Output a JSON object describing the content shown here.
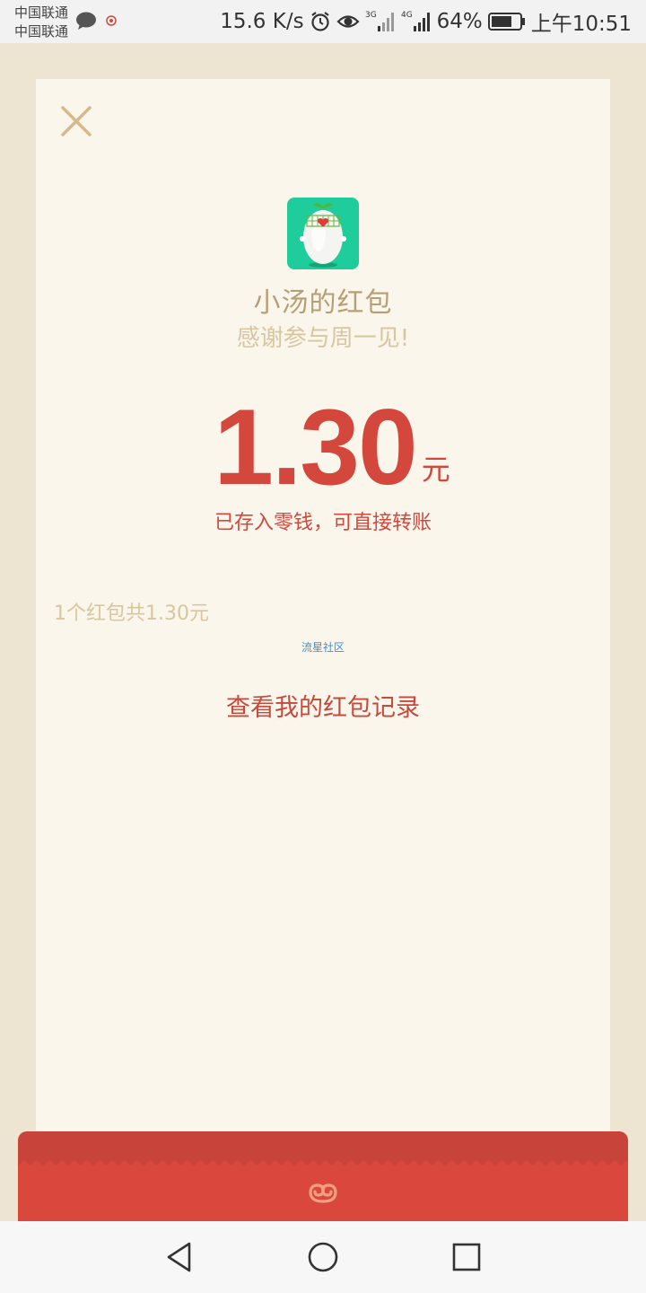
{
  "status_bar": {
    "carrier_1": "中国联通",
    "carrier_2": "中国联通",
    "net_speed": "15.6 K/s",
    "sim1_type": "3G",
    "sim2_type": "4G",
    "battery": "64%",
    "time": "上午10:51"
  },
  "packet": {
    "sender": "小汤的红包",
    "greeting": "感谢参与周一见!",
    "amount": "1.30",
    "unit": "元",
    "saved_note": "已存入零钱，可直接转账",
    "summary": "1个红包共1.30元",
    "source": "流星社区",
    "records_link": "查看我的红包记录"
  },
  "colors": {
    "background": "#ede4d1",
    "card": "#faf6ec",
    "accent_red": "#d4473c",
    "muted_gold": "#b79f74",
    "light_gold": "#d8c6a0",
    "link_blue": "#3d8fd6"
  },
  "icons": {
    "close": "close-icon",
    "avatar": "radish-mascot-avatar",
    "envelope_logo": "cloud-swirl-icon",
    "nav_back": "back-triangle-icon",
    "nav_home": "home-circle-icon",
    "nav_recent": "recent-square-icon"
  }
}
